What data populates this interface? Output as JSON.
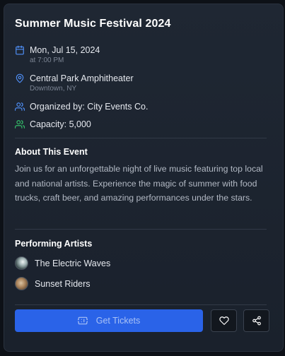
{
  "event": {
    "title": "Summer Music Festival 2024",
    "date": "Mon, Jul 15, 2024",
    "time": "at 7:00 PM",
    "venue": "Central Park Amphitheater",
    "location": "Downtown, NY",
    "organizer": "Organized by: City Events Co.",
    "capacity": "Capacity: 5,000"
  },
  "about": {
    "heading": "About This Event",
    "text": "Join us for an unforgettable night of live music featuring top local and national artists. Experience the magic of summer with food trucks, craft beer, and amazing performances under the stars."
  },
  "artists": {
    "heading": "Performing Artists",
    "items": [
      {
        "name": "The Electric Waves"
      },
      {
        "name": "Sunset Riders"
      }
    ]
  },
  "actions": {
    "get_tickets": "Get Tickets"
  },
  "icons": {
    "date": "calendar-icon",
    "venue": "map-pin-icon",
    "organizer": "users-icon",
    "capacity": "users-icon",
    "tickets": "ticket-icon",
    "favorite": "heart-icon",
    "share": "share-icon"
  },
  "colors": {
    "accent_blue": "#4f8ff7",
    "accent_green": "#34c06a",
    "primary_button": "#2a63e8"
  }
}
